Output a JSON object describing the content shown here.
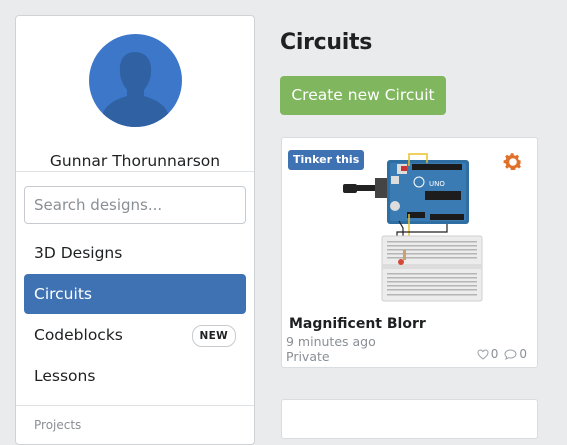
{
  "sidebar": {
    "user_name": "Gunnar Thorunnarson",
    "search_placeholder": "Search designs...",
    "nav": [
      {
        "label": "3D Designs"
      },
      {
        "label": "Circuits"
      },
      {
        "label": "Codeblocks",
        "badge": "NEW"
      },
      {
        "label": "Lessons"
      }
    ],
    "section_label": "Projects"
  },
  "main": {
    "title": "Circuits",
    "create_label": "Create new Circuit",
    "cards": [
      {
        "tinker_label": "Tinker this",
        "name": "Magnificent Blorr",
        "time": "9 minutes ago",
        "privacy": "Private",
        "likes": "0",
        "comments": "0",
        "board_label": "UNO"
      }
    ]
  },
  "colors": {
    "accent_blue": "#3f72b3",
    "create_green": "#7fb65e",
    "gear_orange": "#e0702a",
    "avatar_blue": "#3d77c9"
  },
  "icons": [
    "avatar-silhouette-icon",
    "gear-icon",
    "heart-icon",
    "comment-icon"
  ]
}
